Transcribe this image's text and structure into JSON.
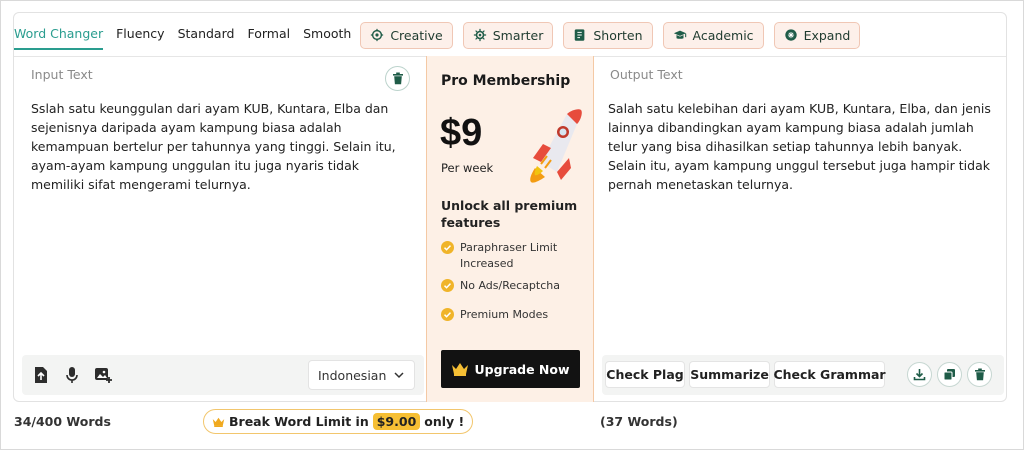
{
  "modes": {
    "tabs": [
      {
        "label": "Word Changer",
        "active": true
      },
      {
        "label": "Fluency"
      },
      {
        "label": "Standard"
      },
      {
        "label": "Formal"
      },
      {
        "label": "Smooth"
      }
    ],
    "premium": [
      {
        "label": "Creative",
        "icon": "brain-icon"
      },
      {
        "label": "Smarter",
        "icon": "gear-icon"
      },
      {
        "label": "Shorten",
        "icon": "shorten-icon"
      },
      {
        "label": "Academic",
        "icon": "graduation-cap-icon"
      },
      {
        "label": "Expand",
        "icon": "expand-icon"
      }
    ]
  },
  "input": {
    "title": "Input Text",
    "lines": [
      "Sslah satu keunggulan dari ayam KUB, Kuntara, Elba dan",
      "sejenisnya daripada ayam kampung biasa adalah",
      "kemampuan bertelur per tahunnya yang tinggi. Selain itu,",
      "ayam-ayam kampung unggulan itu juga nyaris tidak",
      "memiliki sifat mengerami telurnya."
    ],
    "language": "Indonesian",
    "word_count": "34/400 Words"
  },
  "pro": {
    "title": "Pro Membership",
    "price": "$9",
    "period": "Per week",
    "unlock_line1": "Unlock all premium",
    "unlock_line2": "features",
    "features": [
      {
        "line1": "Paraphraser Limit",
        "line2": "Increased"
      },
      {
        "line1": "No Ads/Recaptcha",
        "line2": ""
      },
      {
        "line1": "Premium Modes",
        "line2": ""
      }
    ],
    "upgrade_label": "Upgrade Now"
  },
  "output": {
    "title": "Output Text",
    "lines": [
      "Salah satu kelebihan dari ayam KUB, Kuntara, Elba, dan jenis",
      "lainnya dibandingkan ayam kampung biasa adalah jumlah",
      "telur yang bisa dihasilkan setiap tahunnya lebih banyak.",
      "Selain itu, ayam kampung unggul tersebut juga hampir tidak",
      "pernah menetaskan telurnya."
    ],
    "buttons": {
      "check_plag": "Check Plag",
      "summarize": "Summarize",
      "check_grammar": "Check Grammar"
    },
    "word_count": "(37 Words)"
  },
  "footer": {
    "break_prefix": "Break Word Limit in",
    "break_price": "$9.00",
    "break_suffix": "only !"
  },
  "colors": {
    "accent": "#2a9d8f",
    "pill_bg": "#fdf0ea",
    "pro_bg": "#fdf0e6",
    "gold": "#f6bf34",
    "dark": "#121212"
  }
}
